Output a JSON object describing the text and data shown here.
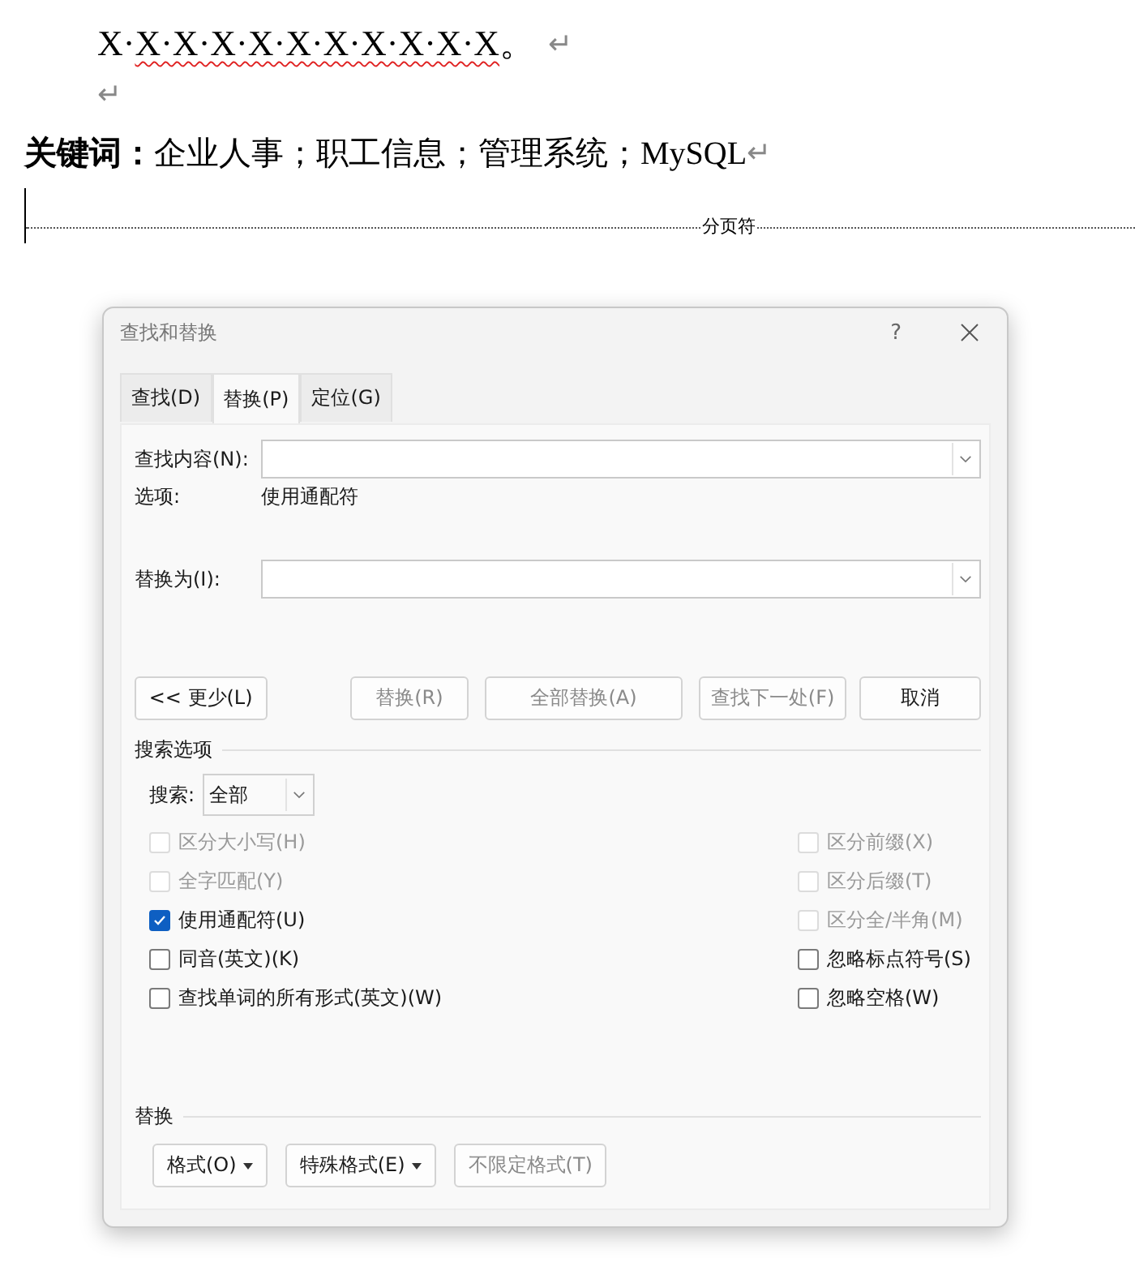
{
  "document": {
    "line": {
      "text": "X·X·X·X·X·X·X·X·X·X·X。",
      "mark": "↵"
    },
    "empty_mark": "↵",
    "keywords": {
      "text": "**关键词：**企业人事；职工信息；管理系统；MySQL",
      "mark": "↵"
    },
    "page_break": "分页符"
  },
  "dialog": {
    "title": "查找和替换",
    "help": "?",
    "tabs": [
      {
        "label": "查找(D)",
        "selected": false
      },
      {
        "label": "替换(P)",
        "selected": true
      },
      {
        "label": "定位(G)",
        "selected": false
      }
    ],
    "find": {
      "label": "查找内容(N):"
    },
    "options": {
      "label": "选项:",
      "value": "使用通配符"
    },
    "replace": {
      "label": "替换为(I):"
    },
    "buttons": [
      {
        "label": "<< 更少(L)",
        "disabled": false
      },
      {
        "label": "替换(R)",
        "disabled": true
      },
      {
        "label": "全部替换(A)",
        "disabled": true
      },
      {
        "label": "查找下一处(F)",
        "disabled": true
      },
      {
        "label": "取消",
        "disabled": false
      }
    ],
    "search_section": "搜索选项",
    "search": {
      "label": "搜索:",
      "value": "全部"
    },
    "left_options": [
      {
        "label": "区分大小写(H)",
        "checked": false,
        "disabled": true
      },
      {
        "label": "全字匹配(Y)",
        "checked": false,
        "disabled": true
      },
      {
        "label": "使用通配符(U)",
        "checked": true,
        "disabled": false
      },
      {
        "label": "同音(英文)(K)",
        "checked": false,
        "disabled": false
      },
      {
        "label": "查找单词的所有形式(英文)(W)",
        "checked": false,
        "disabled": false
      }
    ],
    "right_options": [
      {
        "label": "区分前缀(X)",
        "checked": false,
        "disabled": true
      },
      {
        "label": "区分后缀(T)",
        "checked": false,
        "disabled": true
      },
      {
        "label": "区分全/半角(M)",
        "checked": false,
        "disabled": true
      },
      {
        "label": "忽略标点符号(S)",
        "checked": false,
        "disabled": false
      },
      {
        "label": "忽略空格(W)",
        "checked": false,
        "disabled": false
      }
    ],
    "replace_section": "替换",
    "format_buttons": [
      {
        "label": "格式(O)",
        "kind": "dropdown",
        "disabled": false
      },
      {
        "label": "特殊格式(E)",
        "kind": "dropdown",
        "disabled": false
      },
      {
        "label": "不限定格式(T)",
        "kind": "plain",
        "disabled": true
      }
    ]
  }
}
